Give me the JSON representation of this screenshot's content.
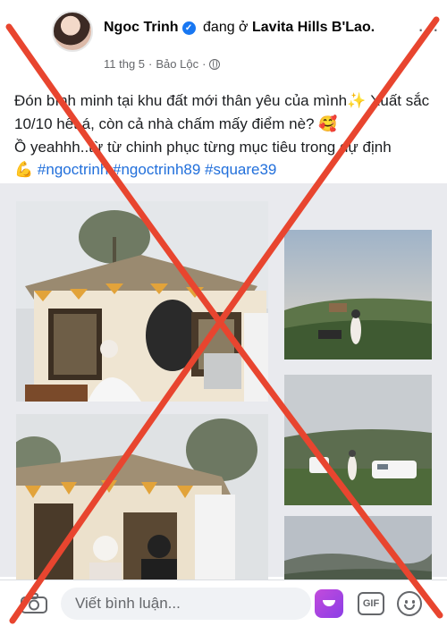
{
  "post": {
    "author": "Ngoc Trinh",
    "location_prefix": "đang ở",
    "location": "Lavita Hills B'Lao.",
    "date": "11 thg 5",
    "place": "Bảo Lộc",
    "separator": "·",
    "more_label": "···"
  },
  "caption": {
    "line1": "Đón bình minh tại khu đất mới thân yêu của mình",
    "sparkle": "✨",
    "line1b": " Xuất sắc 10/10 hết á, còn cả nhà chấm mấy điểm nè?",
    "blush": "🥰",
    "line2": "Ồ yeahhh..từ từ chinh phục từng mục tiêu trong dự định",
    "flex": "💪",
    "hashtags": "#ngoctrinh #ngoctrinh89 #square39"
  },
  "comment_bar": {
    "placeholder": "Viết bình luận...",
    "gif_label": "GIF"
  },
  "icons": {
    "verified": "verified-badge-icon",
    "globe": "globe-icon",
    "camera": "camera-icon",
    "avatar_sticker": "avatar-sticker-icon",
    "gif": "gif-icon",
    "emoji": "emoji-icon"
  },
  "colors": {
    "accent": "#1877f2",
    "hashtag": "#216fdb",
    "overlay_x": "#e8452f"
  }
}
